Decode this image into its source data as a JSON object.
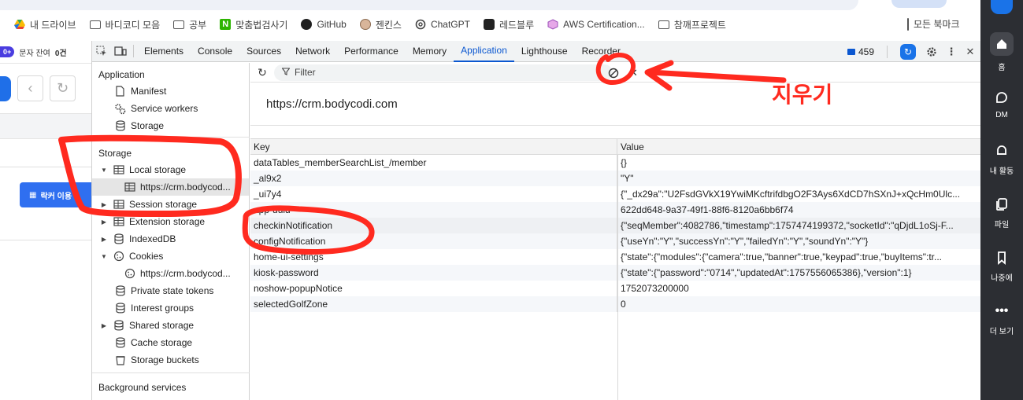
{
  "bookmarks": [
    {
      "icon": "google-drive-icon",
      "label": "내 드라이브"
    },
    {
      "icon": "folder-icon",
      "label": "바디코디 모음"
    },
    {
      "icon": "folder-icon",
      "label": "공부"
    },
    {
      "icon": "naver-n-icon",
      "label": "맞춤법검사기"
    },
    {
      "icon": "github-icon",
      "label": "GitHub"
    },
    {
      "icon": "avatar-icon",
      "label": "젠킨스"
    },
    {
      "icon": "openai-icon",
      "label": "ChatGPT"
    },
    {
      "icon": "redblue-icon",
      "label": "레드블루"
    },
    {
      "icon": "aws-cube-icon",
      "label": "AWS Certification..."
    },
    {
      "icon": "folder-icon",
      "label": "참깨프로젝트"
    }
  ],
  "all_bookmarks_label": "모든 북마크",
  "page": {
    "badge": "0+",
    "notice": "문자 잔여",
    "count": "0건",
    "button_label": "락커 이용"
  },
  "devtools": {
    "tabs": [
      "Elements",
      "Console",
      "Sources",
      "Network",
      "Performance",
      "Memory",
      "Application",
      "Lighthouse",
      "Recorder"
    ],
    "active_tab": "Application",
    "message_count": "459",
    "accent_color": "#0b57d0"
  },
  "sidebar": {
    "application_header": "Application",
    "application_items": [
      "Manifest",
      "Service workers",
      "Storage"
    ],
    "storage_header": "Storage",
    "local_storage": "Local storage",
    "local_origin": "https://crm.bodycod...",
    "session_storage": "Session storage",
    "extension_storage": "Extension storage",
    "indexeddb": "IndexedDB",
    "cookies": "Cookies",
    "cookies_origin": "https://crm.bodycod...",
    "private_state_tokens": "Private state tokens",
    "interest_groups": "Interest groups",
    "shared_storage": "Shared storage",
    "cache_storage": "Cache storage",
    "storage_buckets": "Storage buckets",
    "background_header": "Background services"
  },
  "storage_panel": {
    "filter_placeholder": "Filter",
    "origin": "https://crm.bodycodi.com",
    "col_key": "Key",
    "col_value": "Value",
    "rows": [
      {
        "key": "dataTables_memberSearchList_/member",
        "value": "{}"
      },
      {
        "key": "_al9x2",
        "value": "\"Y\""
      },
      {
        "key": "_ui7y4",
        "value": "{\"_dx29a\":\"U2FsdGVkX19YwiMKcftrifdbgO2F3Ays6XdCD7hSXnJ+xQcHm0Ulc..."
      },
      {
        "key": "app-uuid",
        "value": "622dd648-9a37-49f1-88f6-8120a6bb6f74"
      },
      {
        "key": "checkinNotification",
        "value": "{\"seqMember\":4082786,\"timestamp\":1757474199372,\"socketId\":\"qDjdL1oSj-F..."
      },
      {
        "key": "configNotification",
        "value": "{\"useYn\":\"Y\",\"successYn\":\"Y\",\"failedYn\":\"Y\",\"soundYn\":\"Y\"}"
      },
      {
        "key": "home-ui-settings",
        "value": "{\"state\":{\"modules\":{\"camera\":true,\"banner\":true,\"keypad\":true,\"buyItems\":tr..."
      },
      {
        "key": "kiosk-password",
        "value": "{\"state\":{\"password\":\"0714\",\"updatedAt\":1757556065386},\"version\":1}"
      },
      {
        "key": "noshow-popupNotice",
        "value": "1752073200000"
      },
      {
        "key": "selectedGolfZone",
        "value": "0"
      }
    ]
  },
  "right_sidebar": {
    "items": [
      {
        "icon": "home-icon",
        "label": "홈"
      },
      {
        "icon": "dm-icon",
        "label": "DM"
      },
      {
        "icon": "bell-icon",
        "label": "내 활동"
      },
      {
        "icon": "files-icon",
        "label": "파일"
      },
      {
        "icon": "bookmark-icon",
        "label": "나중에"
      },
      {
        "icon": "more-icon",
        "label": "더 보기"
      }
    ]
  },
  "annotation": {
    "label": "지우기",
    "color": "#ff2a1f"
  }
}
